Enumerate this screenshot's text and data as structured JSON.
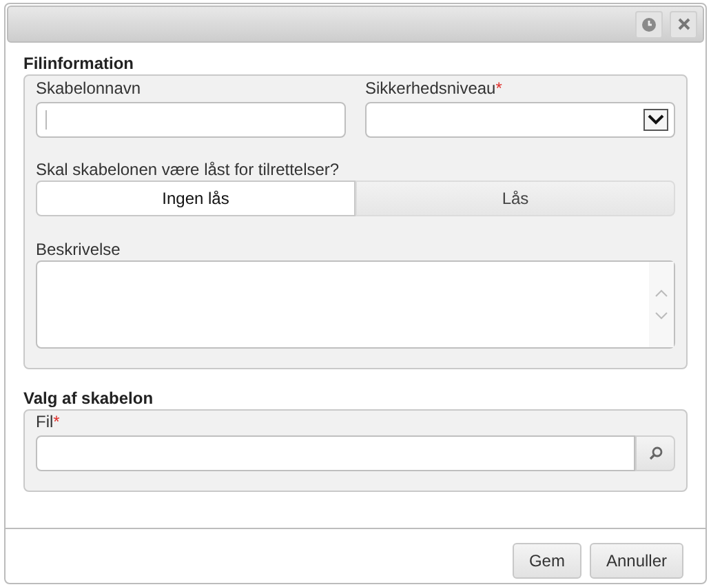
{
  "window": {
    "buttons": [
      {
        "kind": "history"
      },
      {
        "kind": "close"
      }
    ]
  },
  "file_info": {
    "title": "Filinformation",
    "name_field": {
      "label": "Skabelonnavn",
      "focused": true
    },
    "security_field": {
      "label": "Sikkerhedsniveau",
      "required_mark": "*"
    },
    "lock_question": "Skal skabelonen være låst for tilrettelser?",
    "lock_options": [
      {
        "label": "Ingen lås",
        "selected": true
      },
      {
        "label": "Lås",
        "selected": false
      }
    ],
    "description_field": {
      "label": "Beskrivelse"
    }
  },
  "template_choice": {
    "title": "Valg af skabelon",
    "file_field": {
      "label": "Fil",
      "required_mark": "*"
    }
  },
  "buttons": [
    {
      "label": "Gem"
    },
    {
      "label": "Annuller"
    }
  ]
}
